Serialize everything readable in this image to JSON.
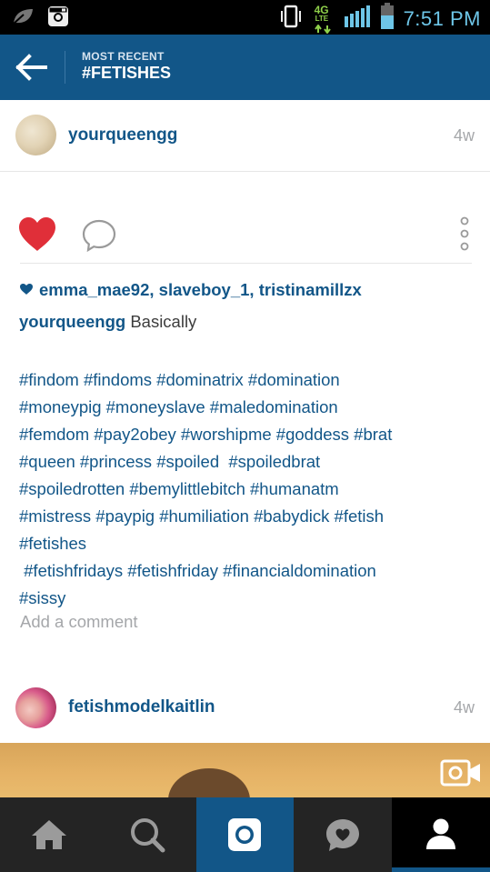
{
  "status_bar": {
    "network": "4G",
    "network_sub": "LTE",
    "time": "7:51 PM"
  },
  "header": {
    "subtitle": "MOST RECENT",
    "title": "#FETISHES"
  },
  "post1": {
    "username": "yourqueengg",
    "time_ago": "4w",
    "liked_by": [
      {
        "user": "emma_mae92",
        "sep": ", "
      },
      {
        "user": "slaveboy_1",
        "sep": ", "
      },
      {
        "user": "tristinamillzx",
        "sep": ""
      }
    ],
    "caption_user": "yourqueengg",
    "caption_text": "Basically",
    "hashtag_lines": [
      "#findom #findoms #dominatrix #domination",
      "#moneypig #moneyslave #maledomination",
      "#femdom #pay2obey #worshipme #goddess #brat",
      "#queen #princess #spoiled  #spoiledbrat",
      "#spoiledrotten #bemylittlebitch #humanatm",
      "#mistress #paypig #humiliation #babydick #fetish",
      "#fetishes",
      " #fetishfridays #fetishfriday #financialdomination",
      "#sissy"
    ],
    "add_comment": "Add a comment"
  },
  "post2": {
    "username": "fetishmodelkaitlin",
    "time_ago": "4w"
  },
  "colors": {
    "brand_blue": "#125688",
    "like_red": "#e02f39",
    "muted_gray": "#a5a7aa",
    "status_cyan": "#6ec6e8"
  },
  "tab_bar": {
    "tabs": [
      "home-icon",
      "search-icon",
      "camera-icon",
      "activity-icon",
      "profile-icon"
    ],
    "active": "camera-icon"
  }
}
